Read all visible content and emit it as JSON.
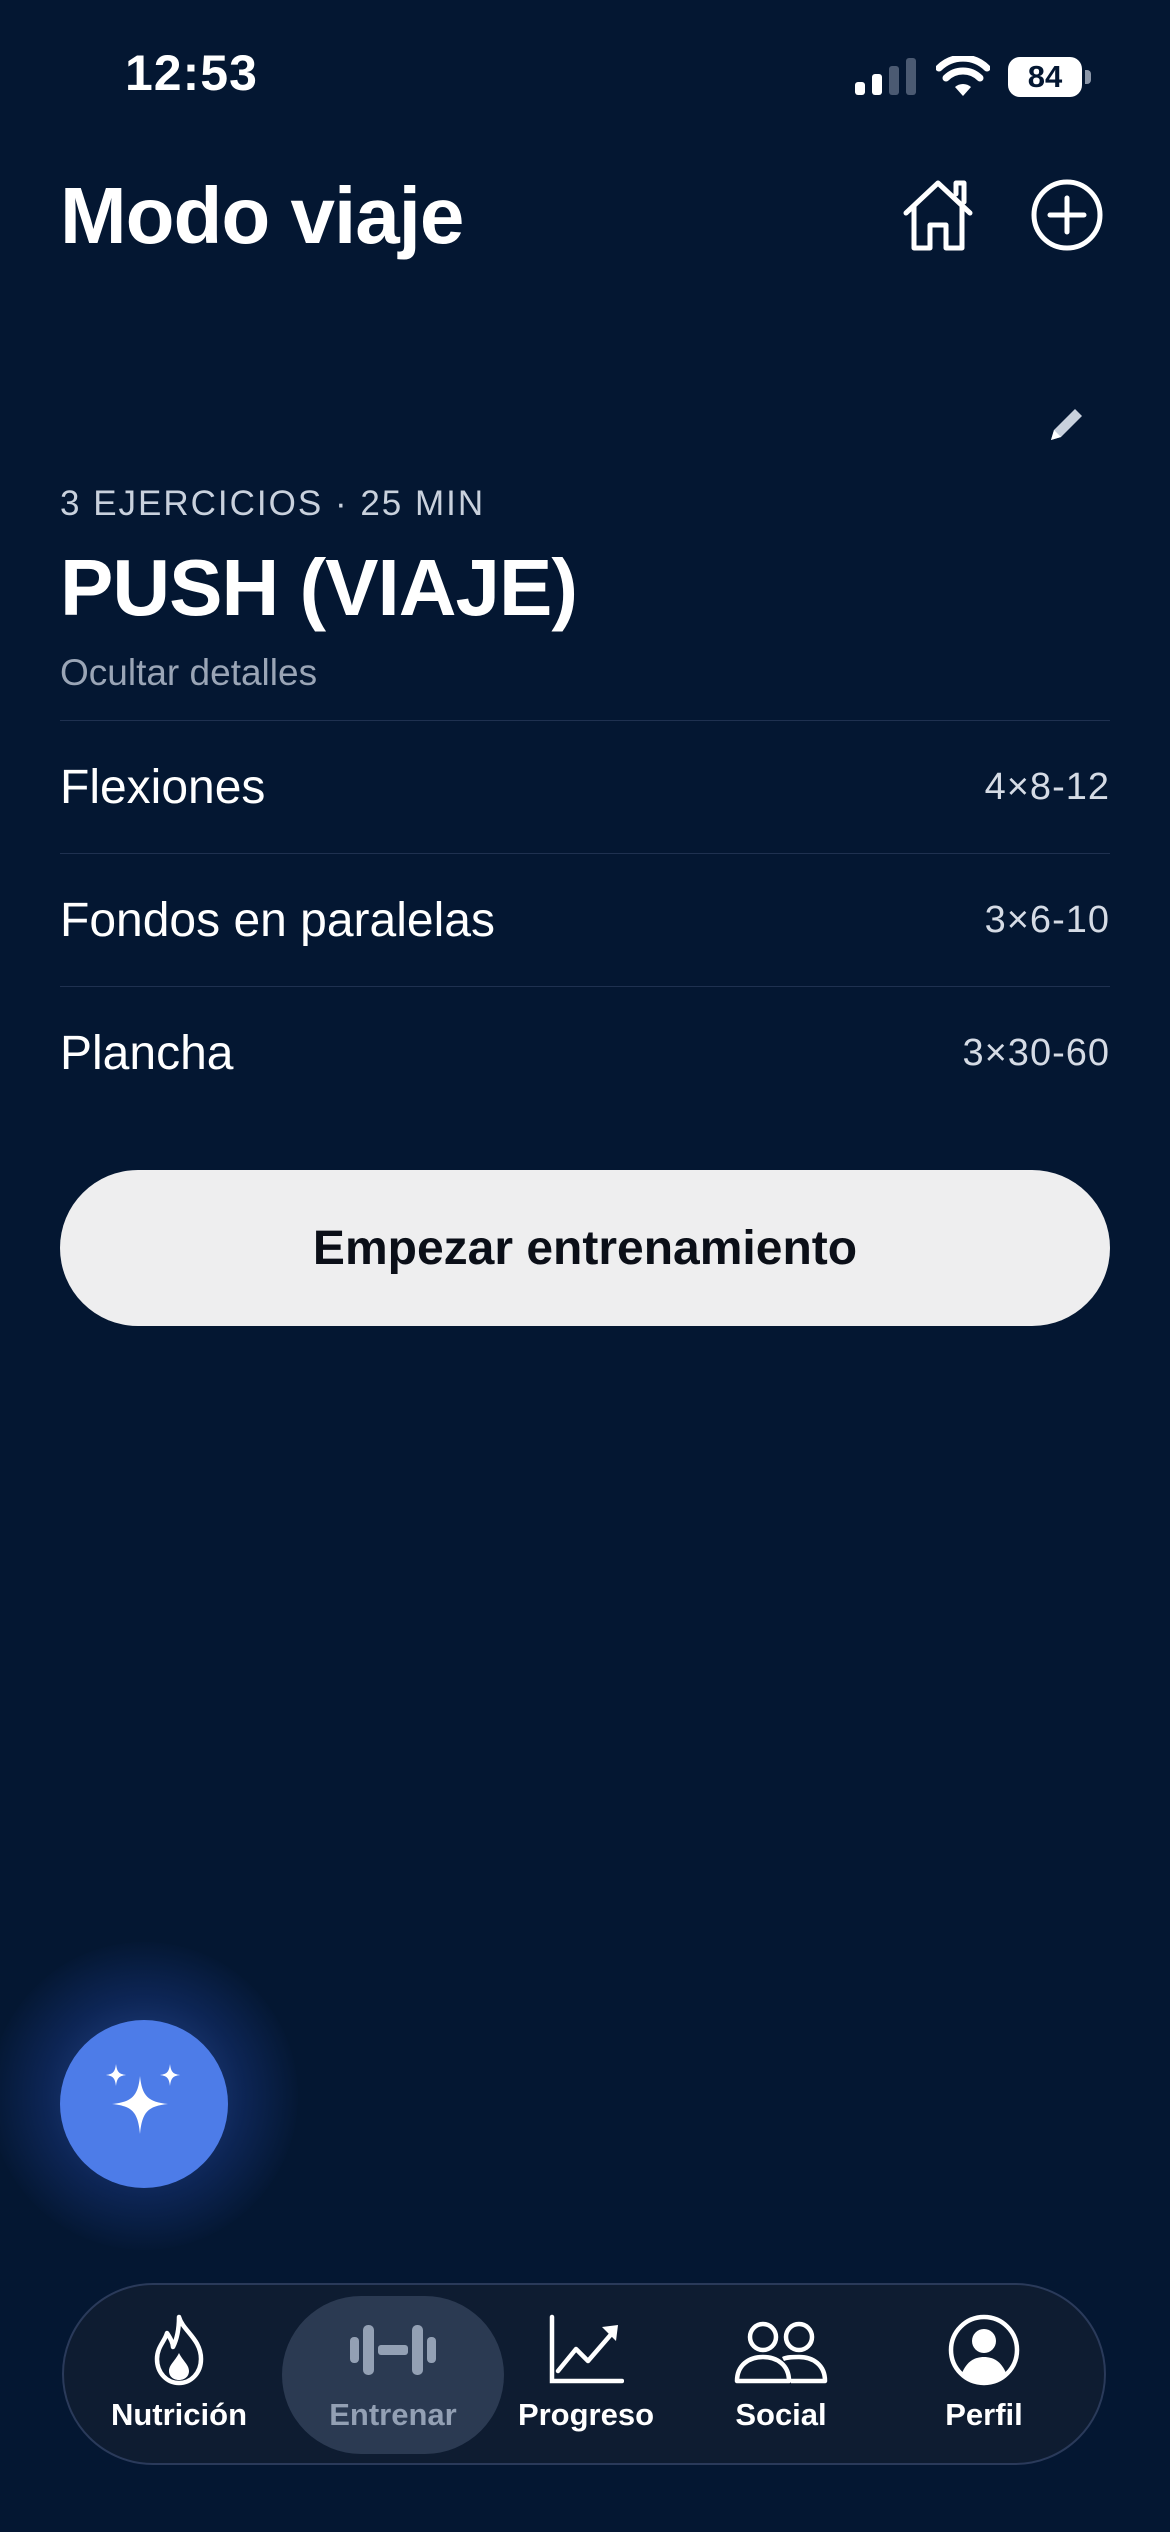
{
  "status_bar": {
    "time": "12:53",
    "battery": "84"
  },
  "header": {
    "title": "Modo viaje"
  },
  "workout": {
    "meta": "3 EJERCICIOS · 25 MIN",
    "title": "PUSH (VIAJE)",
    "toggle_details": "Ocultar detalles",
    "exercises": [
      {
        "name": "Flexiones",
        "sets": "4×8-12"
      },
      {
        "name": "Fondos en paralelas",
        "sets": "3×6-10"
      },
      {
        "name": "Plancha",
        "sets": "3×30-60"
      }
    ]
  },
  "start_button": "Empezar entrenamiento",
  "tabbar": {
    "active": "Entrenar",
    "tabs": [
      {
        "label": "Nutrición",
        "icon": "flame-icon"
      },
      {
        "label": "Entrenar",
        "icon": "dumbbell-icon"
      },
      {
        "label": "Progreso",
        "icon": "chart-icon"
      },
      {
        "label": "Social",
        "icon": "people-icon"
      },
      {
        "label": "Perfil",
        "icon": "profile-icon"
      }
    ]
  },
  "fab": {
    "icon": "sparkles-icon"
  },
  "colors": {
    "background": "#041732",
    "fab": "#4d7ce8",
    "button": "#eeeeef",
    "tabbar": "#0e1c31"
  }
}
